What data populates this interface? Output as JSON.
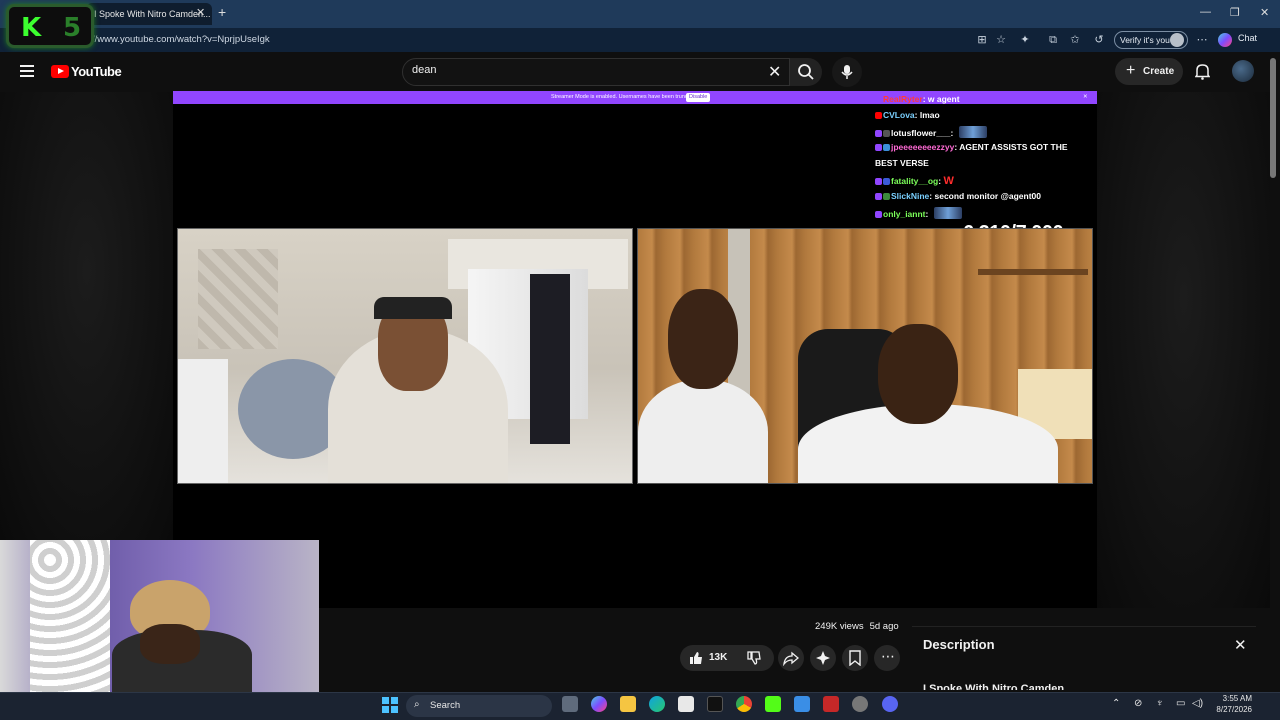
{
  "browser": {
    "tab_title": "I Spoke With Nitro Camden...",
    "url": "//www.youtube.com/watch?v=NprjpUseIgk",
    "verify_label": "Verify it's you",
    "chat_label": "Chat"
  },
  "overlay": {
    "k_label": "K",
    "number": "5"
  },
  "youtube": {
    "logo_text": "YouTube",
    "search_value": "dean",
    "create_label": "Create"
  },
  "stream": {
    "banner_text": "Streamer Mode is enabled. Usernames have been truncated.",
    "banner_button": "Disable",
    "counter": "6,210/7,000",
    "chat": [
      {
        "user": "RealRyter",
        "text": "w agent",
        "color": "#ff3b3b"
      },
      {
        "user": "CVLova",
        "text": "lmao",
        "color": "#7ad0ff"
      },
      {
        "user": "lotusflower___",
        "text": "",
        "color": "#ffffff"
      },
      {
        "user": "jpeeeeeeeezzyy",
        "text": "AGENT ASSISTS GOT THE",
        "color": "#ff6ad5"
      },
      {
        "user": "",
        "text": "BEST VERSE",
        "color": "#ffffff"
      },
      {
        "user": "fatality__og",
        "text": "W",
        "color": "#7cff5a"
      },
      {
        "user": "SlickNine",
        "text": "second monitor @agent00",
        "color": "#7ad0ff"
      },
      {
        "user": "only_iannt",
        "text": "",
        "color": "#7cff5a"
      }
    ]
  },
  "video": {
    "views": "249K views",
    "age": "5d ago",
    "likes": "13K"
  },
  "description": {
    "title": "Description",
    "snippet": "I Spoke With Nitro Camden"
  },
  "taskbar": {
    "search_label": "Search",
    "time": "3:55 AM",
    "date": "8/27/2026"
  }
}
